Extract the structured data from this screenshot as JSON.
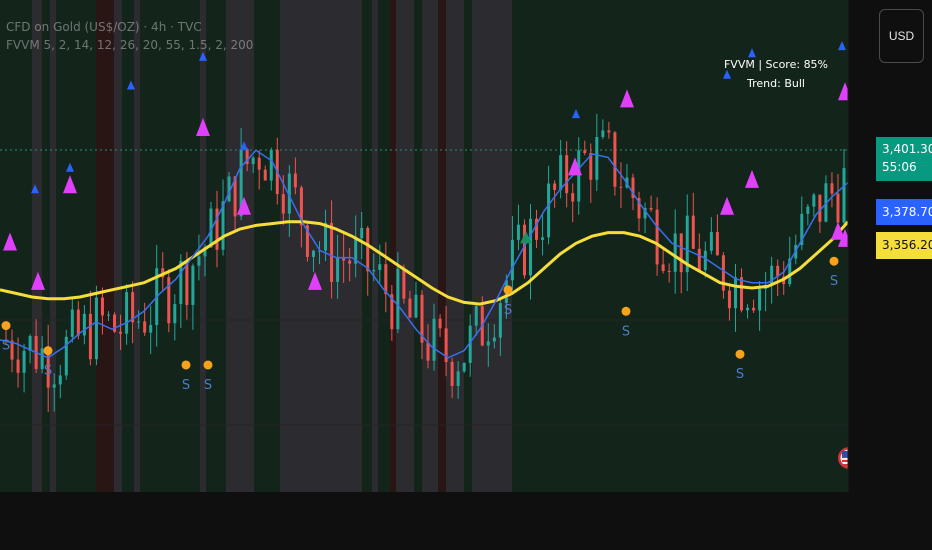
{
  "header": {
    "symbol_line": "CFD on Gold (US$/OZ) · 4h · TVC",
    "indicator_line": "FVVM 5, 2, 14, 12, 26, 20, 55, 1.5, 2, 200"
  },
  "info_box": {
    "line1": "FVVM | Score: 85%",
    "line2": "Trend: Bull"
  },
  "currency_button": {
    "label": "USD"
  },
  "price_tags": {
    "last_price": "3,401.300",
    "countdown": "55:06",
    "fast_ma_value": "3,378.705",
    "slow_ma_value": "3,356.208"
  },
  "colors": {
    "background": "#0f0f0f",
    "bull_candle": "#26a69a",
    "bear_candle": "#ef5350",
    "fast_ma": "#3a6ff0",
    "slow_ma": "#f5dd3a",
    "bull_zone": "#13251a",
    "bear_zone": "#2a1515",
    "neutral_zone": "#303034",
    "triangle_magenta": "#e040fb",
    "triangle_blue": "#2962ff",
    "dot_orange": "#f7a21b",
    "s_label": "#4a7ec8"
  },
  "markers": {
    "s_label": "S"
  },
  "chart_data": {
    "type": "line",
    "title": "",
    "series": [
      {
        "name": "",
        "values": [
          3290,
          3288,
          3284,
          3280,
          3286,
          3294,
          3300,
          3296,
          3300,
          3306,
          3316,
          3324,
          3336,
          3348,
          3366,
          3386,
          3396,
          3390,
          3372,
          3354,
          3340,
          3336,
          3336,
          3330,
          3318,
          3308,
          3296,
          3286,
          3280,
          3284,
          3296,
          3312,
          3330,
          3346,
          3362,
          3374,
          3384,
          3394,
          3392,
          3380,
          3366,
          3354,
          3344,
          3340,
          3336,
          3330,
          3324,
          3322,
          3322,
          3328,
          3344,
          3360,
          3370,
          3378
        ]
      },
      {
        "name": "",
        "values": [
          3318,
          3316,
          3314,
          3313,
          3313,
          3314,
          3316,
          3318,
          3320,
          3322,
          3326,
          3330,
          3336,
          3342,
          3348,
          3352,
          3354,
          3355,
          3356,
          3356,
          3355,
          3352,
          3348,
          3343,
          3337,
          3331,
          3325,
          3319,
          3314,
          3311,
          3310,
          3312,
          3316,
          3322,
          3330,
          3338,
          3344,
          3348,
          3350,
          3350,
          3348,
          3344,
          3338,
          3332,
          3327,
          3322,
          3320,
          3319,
          3320,
          3324,
          3330,
          3338,
          3346,
          3356
        ]
      }
    ],
    "candle_range": [
      3220,
      3470
    ],
    "ylim": [
      3205,
      3480
    ],
    "grid": true,
    "background_zones": [
      "bull",
      "neutral",
      "bull",
      "neutral",
      "bull",
      "bear",
      "neutral",
      "bull",
      "neutral",
      "bull",
      "neutral",
      "bull",
      "neutral",
      "bull",
      "bull",
      "neutral",
      "bull",
      "neutral",
      "bull",
      "bear",
      "neutral",
      "bull",
      "neutral",
      "bear",
      "neutral",
      "bull",
      "neutral",
      "bull"
    ],
    "signals": {
      "magenta_triangles": [
        3340,
        3318,
        3372,
        3404,
        3360,
        3318,
        3382,
        3420,
        3360,
        3375,
        3346,
        3342,
        3424
      ],
      "blue_triangles": [
        3372,
        3384,
        3430,
        3446,
        3396,
        3414,
        3436,
        3448,
        3452
      ],
      "orange_dots": [
        3298,
        3284,
        3276,
        3276,
        3318,
        3306,
        3282,
        3334
      ],
      "green_triangles": [
        3344
      ]
    }
  }
}
